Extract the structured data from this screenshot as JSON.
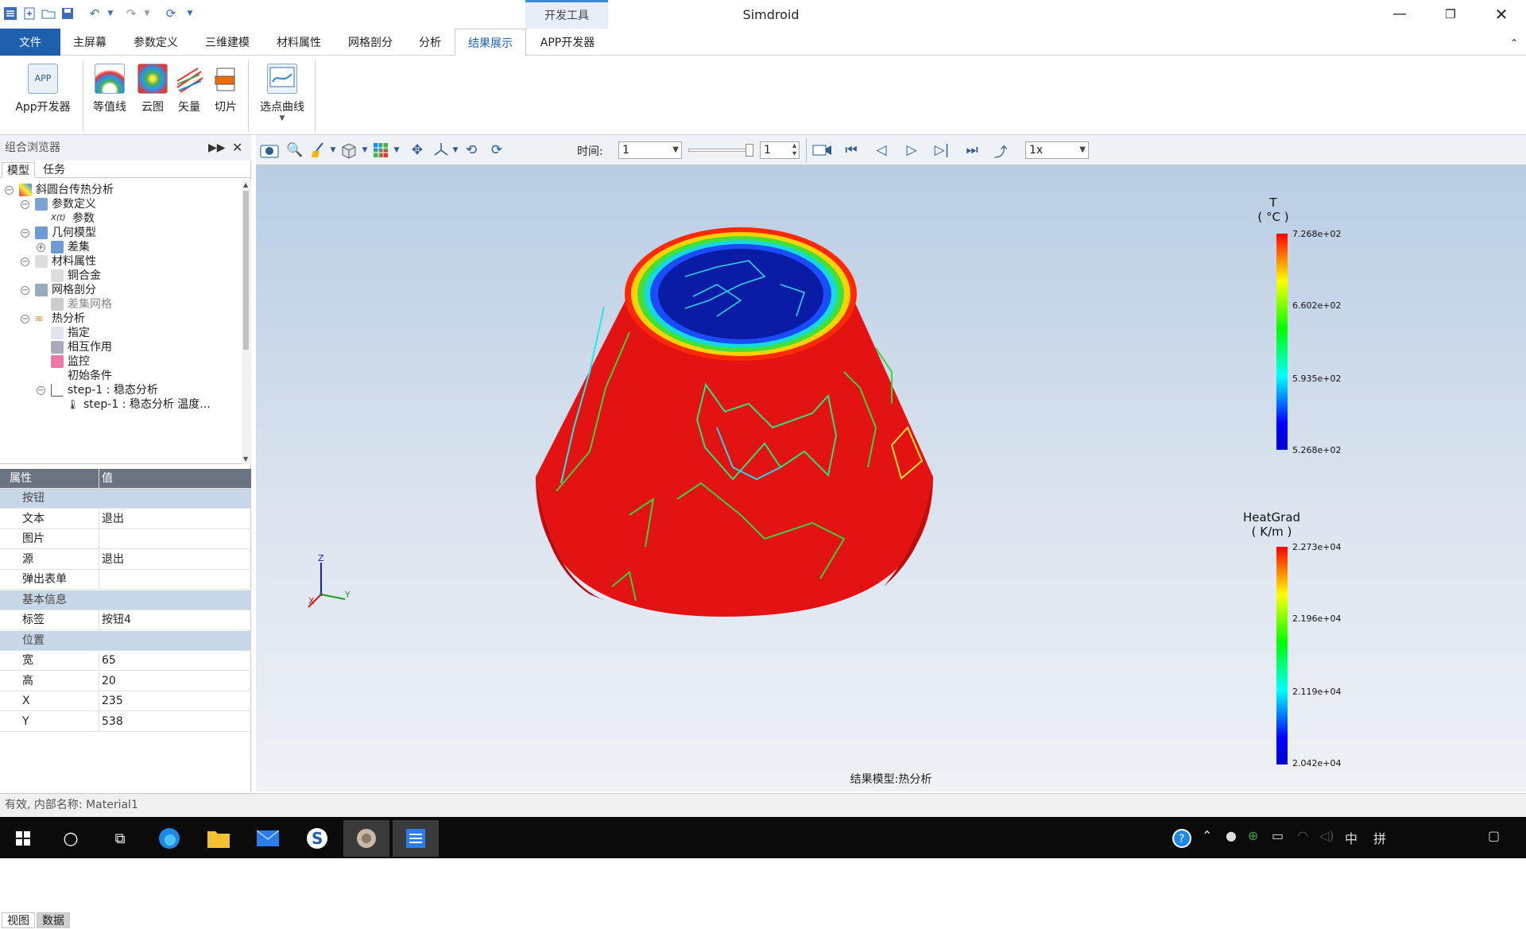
{
  "window": {
    "app_title": "Simdroid",
    "context_tab": "开发工具"
  },
  "menu": {
    "items": [
      "文件",
      "主屏幕",
      "参数定义",
      "三维建模",
      "材料属性",
      "网格剖分",
      "分析",
      "结果展示",
      "APP开发器"
    ],
    "active": "结果展示"
  },
  "ribbon": {
    "buttons": [
      {
        "label": "App开发器",
        "icon": "app-icon"
      },
      {
        "label": "等值线",
        "icon": "contour-icon"
      },
      {
        "label": "云图",
        "icon": "cloud-map-icon"
      },
      {
        "label": "矢量",
        "icon": "vector-icon"
      },
      {
        "label": "切片",
        "icon": "slice-icon"
      },
      {
        "label": "选点曲线",
        "icon": "point-curve-icon"
      }
    ]
  },
  "browser": {
    "title": "组合浏览器",
    "tabs": [
      "模型",
      "任务"
    ],
    "tree": [
      {
        "label": "斜圆台传热分析",
        "level": 0,
        "exp": "−",
        "icon": "model-icon"
      },
      {
        "label": "参数定义",
        "level": 1,
        "exp": "−",
        "icon": "parameter-icon"
      },
      {
        "label": "参数",
        "level": 2,
        "exp": "",
        "icon": "variable-icon",
        "glyph": "X(t)"
      },
      {
        "label": "几何模型",
        "level": 1,
        "exp": "−",
        "icon": "geometry-icon"
      },
      {
        "label": "差集",
        "level": 2,
        "exp": "+",
        "icon": "difference-icon"
      },
      {
        "label": "材料属性",
        "level": 1,
        "exp": "−",
        "icon": "material-icon"
      },
      {
        "label": "铜合金",
        "level": 2,
        "exp": "",
        "icon": "copper-alloy-icon"
      },
      {
        "label": "网格剖分",
        "level": 1,
        "exp": "−",
        "icon": "mesh-icon"
      },
      {
        "label": "差集网格",
        "level": 2,
        "exp": "",
        "icon": "mesh-item-icon",
        "muted": true
      },
      {
        "label": "热分析",
        "level": 1,
        "exp": "−",
        "icon": "heat-analysis-icon"
      },
      {
        "label": "指定",
        "level": 2,
        "exp": "",
        "icon": "assign-icon"
      },
      {
        "label": "相互作用",
        "level": 2,
        "exp": "",
        "icon": "interaction-icon"
      },
      {
        "label": "监控",
        "level": 2,
        "exp": "",
        "icon": "monitor-icon"
      },
      {
        "label": "初始条件",
        "level": 2,
        "exp": "",
        "icon": "initial-condition-icon"
      },
      {
        "label": "step-1 : 稳态分析",
        "level": 2,
        "exp": "−",
        "icon": "step-icon"
      },
      {
        "label": "step-1 : 稳态分析 温度...",
        "level": 3,
        "exp": "",
        "icon": "thermometer-icon"
      }
    ]
  },
  "properties": {
    "col_key": "属性",
    "col_value": "值",
    "rows": [
      {
        "type": "grp",
        "k": "按钮",
        "v": ""
      },
      {
        "type": "row",
        "k": "文本",
        "v": "退出"
      },
      {
        "type": "row",
        "k": "图片",
        "v": ""
      },
      {
        "type": "row",
        "k": "源",
        "v": "退出"
      },
      {
        "type": "row",
        "k": "弹出表单",
        "v": ""
      },
      {
        "type": "grp",
        "k": "基本信息",
        "v": ""
      },
      {
        "type": "row",
        "k": "标签",
        "v": "按钮4"
      },
      {
        "type": "grp",
        "k": "位置",
        "v": ""
      },
      {
        "type": "row",
        "k": "宽",
        "v": "65"
      },
      {
        "type": "row",
        "k": "高",
        "v": "20"
      },
      {
        "type": "row",
        "k": "X",
        "v": "235"
      },
      {
        "type": "row",
        "k": "Y",
        "v": "538"
      }
    ]
  },
  "bottom_tabs": [
    "视图",
    "数据"
  ],
  "view_toolbar": {
    "time_label": "时间:",
    "time_value": "1",
    "step_value": "1",
    "speed_value": "1x"
  },
  "viewport": {
    "caption": "结果模型:热分析",
    "axes": {
      "z": "Z",
      "y": "Y",
      "x": "X"
    },
    "legend_temp": {
      "title": "T",
      "unit": "( °C )",
      "labels": [
        "7.268e+02",
        "6.602e+02",
        "5.935e+02",
        "5.268e+02"
      ]
    },
    "legend_grad": {
      "title": "HeatGrad",
      "unit": "( K/m )",
      "labels": [
        "2.273e+04",
        "2.196e+04",
        "2.119e+04",
        "2.042e+04"
      ]
    }
  },
  "status": {
    "text": "有效, 内部名称: Material1"
  }
}
